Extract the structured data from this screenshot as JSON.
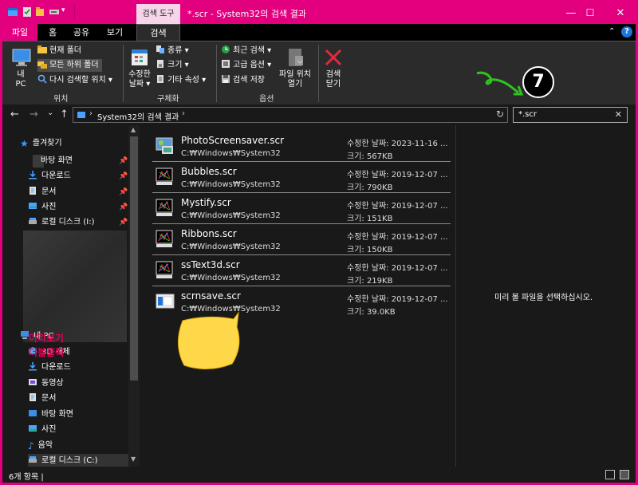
{
  "titlebar": {
    "tool_tab": "검색 도구",
    "title": "*.scr - System32의 검색 결과",
    "minimize": "—",
    "maximize": "☐",
    "close": "✕"
  },
  "tabs": {
    "file": "파일",
    "home": "홈",
    "share": "공유",
    "view": "보기",
    "search": "검색",
    "collapse": "⌃",
    "help": "?"
  },
  "ribbon": {
    "location": {
      "label": "위치",
      "this_pc": "내 PC",
      "this_pc_line1": "내",
      "this_pc_line2": "PC",
      "current_folder": "현재 폴더",
      "all_subfolders": "모든 하위 폴더",
      "search_again": "다시 검색할 위치 ▾"
    },
    "refine": {
      "label": "구체화",
      "date_modified_line1": "수정한",
      "date_modified_line2": "날짜 ▾",
      "kind": "종류 ▾",
      "size": "크기 ▾",
      "other_props": "기타 속성 ▾"
    },
    "options": {
      "label": "옵션",
      "recent_searches": "최근 검색 ▾",
      "advanced_options": "고급 옵션 ▾",
      "save_search": "검색 저장",
      "open_location_line1": "파일 위치",
      "open_location_line2": "열기"
    },
    "close_search_line1": "검색",
    "close_search_line2": "닫기"
  },
  "nav": {
    "back": "←",
    "forward": "→",
    "recent": "⌄",
    "up": "↑",
    "address": "System32의 검색 결과",
    "address_arrow": "›",
    "refresh": "↻",
    "search_value": "*.scr",
    "search_clear": "✕"
  },
  "sidebar": {
    "quick_access": "즐겨찾기",
    "quick_items": [
      "바탕 화면",
      "다운로드",
      "문서",
      "사진",
      "로컬 디스크 (I:)"
    ],
    "this_pc": "내 PC",
    "pc_items": [
      "3D 개체",
      "다운로드",
      "동영상",
      "문서",
      "바탕 화면",
      "사진",
      "음악",
      "로컬 디스크 (C:)"
    ]
  },
  "files": [
    {
      "name": "PhotoScreensaver.scr",
      "path": "C:₩Windows₩System32",
      "modified": "수정한 날짜: 2023-11-16 ...",
      "size": "크기: 567KB",
      "icon": "photo-screensaver-icon"
    },
    {
      "name": "Bubbles.scr",
      "path": "C:₩Windows₩System32",
      "modified": "수정한 날짜: 2019-12-07 ...",
      "size": "크기: 790KB",
      "icon": "screensaver-icon"
    },
    {
      "name": "Mystify.scr",
      "path": "C:₩Windows₩System32",
      "modified": "수정한 날짜: 2019-12-07 ...",
      "size": "크기: 151KB",
      "icon": "screensaver-icon"
    },
    {
      "name": "Ribbons.scr",
      "path": "C:₩Windows₩System32",
      "modified": "수정한 날짜: 2019-12-07 ...",
      "size": "크기: 150KB",
      "icon": "screensaver-icon"
    },
    {
      "name": "ssText3d.scr",
      "path": "C:₩Windows₩System32",
      "modified": "수정한 날짜: 2019-12-07 ...",
      "size": "크기: 219KB",
      "icon": "screensaver-icon"
    },
    {
      "name": "scrnsave.scr",
      "path": "C:₩Windows₩System32",
      "modified": "수정한 날짜: 2019-12-07 ...",
      "size": "크기: 39.0KB",
      "icon": "blank-screensaver-icon"
    }
  ],
  "preview": {
    "message": "미리 볼 파일을 선택하십시오."
  },
  "status": {
    "count": "6개 항목  |"
  },
  "annotation": {
    "callout_line1": "미리보기",
    "callout_line2": "더블클릭",
    "step": "7"
  },
  "colors": {
    "accent": "#e3007f",
    "background": "#191919",
    "ribbon": "#2b2b2b"
  }
}
